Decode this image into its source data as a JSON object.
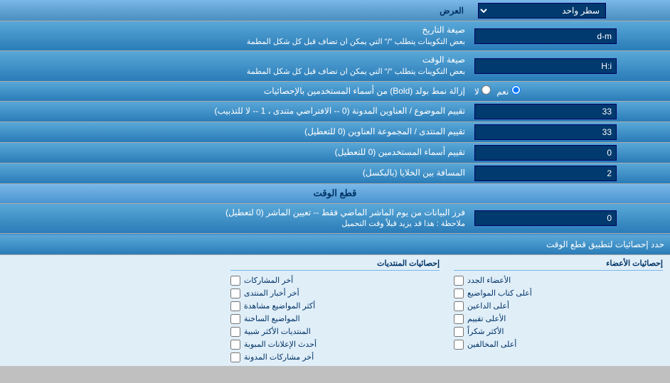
{
  "header": {
    "display_label": "العرض",
    "single_line_label": "سطر واحد"
  },
  "rows": [
    {
      "id": "date_format",
      "label": "صيغة التاريخ",
      "sublabel": "بعض التكوينات يتطلب \"/\" التي يمكن ان تضاف قبل كل شكل المطمة",
      "value": "d-m",
      "type": "input"
    },
    {
      "id": "time_format",
      "label": "صيغة الوقت",
      "sublabel": "بعض التكوينات يتطلب \"/\" التي يمكن ان تضاف قبل كل شكل المطمة",
      "value": "H:i",
      "type": "input"
    },
    {
      "id": "bold_remove",
      "label": "إزالة نمط بولد (Bold) من أسماء المستخدمين بالإحصائيات",
      "type": "radio",
      "options": [
        "نعم",
        "لا"
      ],
      "selected": "نعم"
    },
    {
      "id": "topics_order",
      "label": "تقييم الموضوع / العناوين المدونة (0 -- الافتراضي متندى ، 1 -- لا للتذبيب)",
      "value": "33",
      "type": "input"
    },
    {
      "id": "forum_order",
      "label": "تقييم المنتدى / المجموعة العناوين (0 للتعطيل)",
      "value": "33",
      "type": "input"
    },
    {
      "id": "users_order",
      "label": "تقييم أسماء المستخدمين (0 للتعطيل)",
      "value": "0",
      "type": "input"
    },
    {
      "id": "spacing",
      "label": "المسافة بين الخلايا (بالبكسل)",
      "value": "2",
      "type": "input"
    }
  ],
  "section_cutoff": {
    "title": "قطع الوقت",
    "row": {
      "label": "فرز البيانات من يوم الماشر الماضي فقط -- تعيين الماشر (0 لتعطيل)",
      "note": "ملاحظة : هذا قد يزيد قبلاً وقت التحميل",
      "value": "0"
    },
    "stats_label": "حدد إحصائيات لتطبيق قطع الوقت"
  },
  "checkboxes": {
    "col1_header": "إحصائيات الأعضاء",
    "col1_items": [
      "الأعضاء الجدد",
      "أعلى كتاب المواضيع",
      "أعلى الداعين",
      "الأعلى تقييم",
      "الأكثر شكراً",
      "أعلى المخالفين"
    ],
    "col2_header": "إحصائيات المنتديات",
    "col2_items": [
      "أخر المشاركات",
      "أخر أخبار المنتدى",
      "أكثر المواضيع مشاهدة",
      "المواضيع الساخنة",
      "المنتديات الأكثر شبية",
      "أحدث الإعلانات المبوبة",
      "أخر مشاركات المدونة"
    ]
  }
}
